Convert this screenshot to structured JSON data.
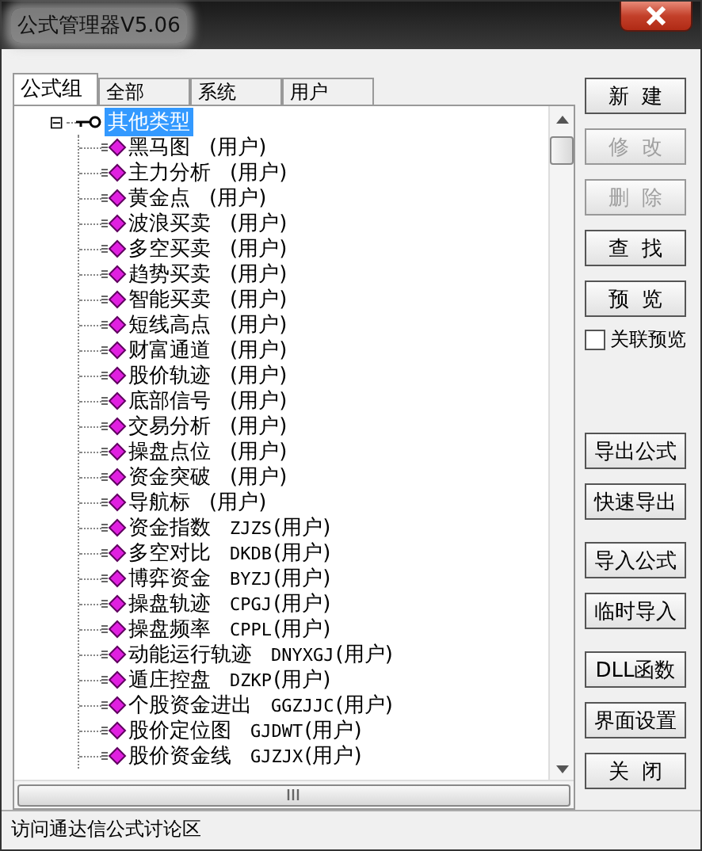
{
  "window": {
    "title": "公式管理器V5.06"
  },
  "tabs": [
    {
      "label": "公式组",
      "selected": true
    },
    {
      "label": "全部",
      "selected": false
    },
    {
      "label": "系统",
      "selected": false
    },
    {
      "label": "用户",
      "selected": false
    }
  ],
  "tree": {
    "label": "其他类型",
    "selected": true,
    "expanded": true,
    "toggle": "⊟",
    "children": [
      {
        "name": "黑马图",
        "tag": "(用户)"
      },
      {
        "name": "主力分析",
        "tag": "(用户)"
      },
      {
        "name": "黄金点",
        "tag": "(用户)"
      },
      {
        "name": "波浪买卖",
        "tag": "(用户)"
      },
      {
        "name": "多空买卖",
        "tag": "(用户)"
      },
      {
        "name": "趋势买卖",
        "tag": "(用户)"
      },
      {
        "name": "智能买卖",
        "tag": "(用户)"
      },
      {
        "name": "短线高点",
        "tag": "(用户)"
      },
      {
        "name": "财富通道",
        "tag": "(用户)"
      },
      {
        "name": "股价轨迹",
        "tag": "(用户)"
      },
      {
        "name": "底部信号",
        "tag": "(用户)"
      },
      {
        "name": "交易分析",
        "tag": "(用户)"
      },
      {
        "name": "操盘点位",
        "tag": "(用户)"
      },
      {
        "name": "资金突破",
        "tag": "(用户)"
      },
      {
        "name": "导航标",
        "tag": "(用户)"
      },
      {
        "name": "资金指数",
        "code": "ZJZS",
        "tag": "(用户)"
      },
      {
        "name": "多空对比",
        "code": "DKDB",
        "tag": "(用户)"
      },
      {
        "name": "博弈资金",
        "code": "BYZJ",
        "tag": "(用户)"
      },
      {
        "name": "操盘轨迹",
        "code": "CPGJ",
        "tag": "(用户)"
      },
      {
        "name": "操盘频率",
        "code": "CPPL",
        "tag": "(用户)"
      },
      {
        "name": "动能运行轨迹",
        "code": "DNYXGJ",
        "tag": "(用户)"
      },
      {
        "name": "遁庄控盘",
        "code": "DZKP",
        "tag": "(用户)"
      },
      {
        "name": "个股资金进出",
        "code": "GGZJJC",
        "tag": "(用户)"
      },
      {
        "name": "股价定位图",
        "code": "GJDWT",
        "tag": "(用户)"
      },
      {
        "name": "股价资金线",
        "code": "GJZJX",
        "tag": "(用户)"
      }
    ]
  },
  "buttons": [
    {
      "label": "新  建",
      "disabled": false,
      "gap": false
    },
    {
      "label": "修  改",
      "disabled": true,
      "gap": false
    },
    {
      "label": "删  除",
      "disabled": true,
      "gap": false
    },
    {
      "label": "查  找",
      "disabled": false,
      "gap": false
    },
    {
      "label": "预  览",
      "disabled": false,
      "gap": false
    }
  ],
  "checkbox": {
    "label": "关联预览",
    "checked": false
  },
  "buttons_2": [
    {
      "label": "导出公式",
      "disabled": false,
      "gap": false
    },
    {
      "label": "快速导出",
      "disabled": false,
      "gap": false
    },
    {
      "label": "导入公式",
      "disabled": false,
      "gap": true
    },
    {
      "label": "临时导入",
      "disabled": false,
      "gap": false
    },
    {
      "label": "DLL函数",
      "disabled": false,
      "gap": true
    },
    {
      "label": "界面设置",
      "disabled": false,
      "gap": false
    },
    {
      "label": "关  闭",
      "disabled": false,
      "gap": false
    }
  ],
  "status_bar": {
    "text": "访问通达信公式讨论区"
  }
}
